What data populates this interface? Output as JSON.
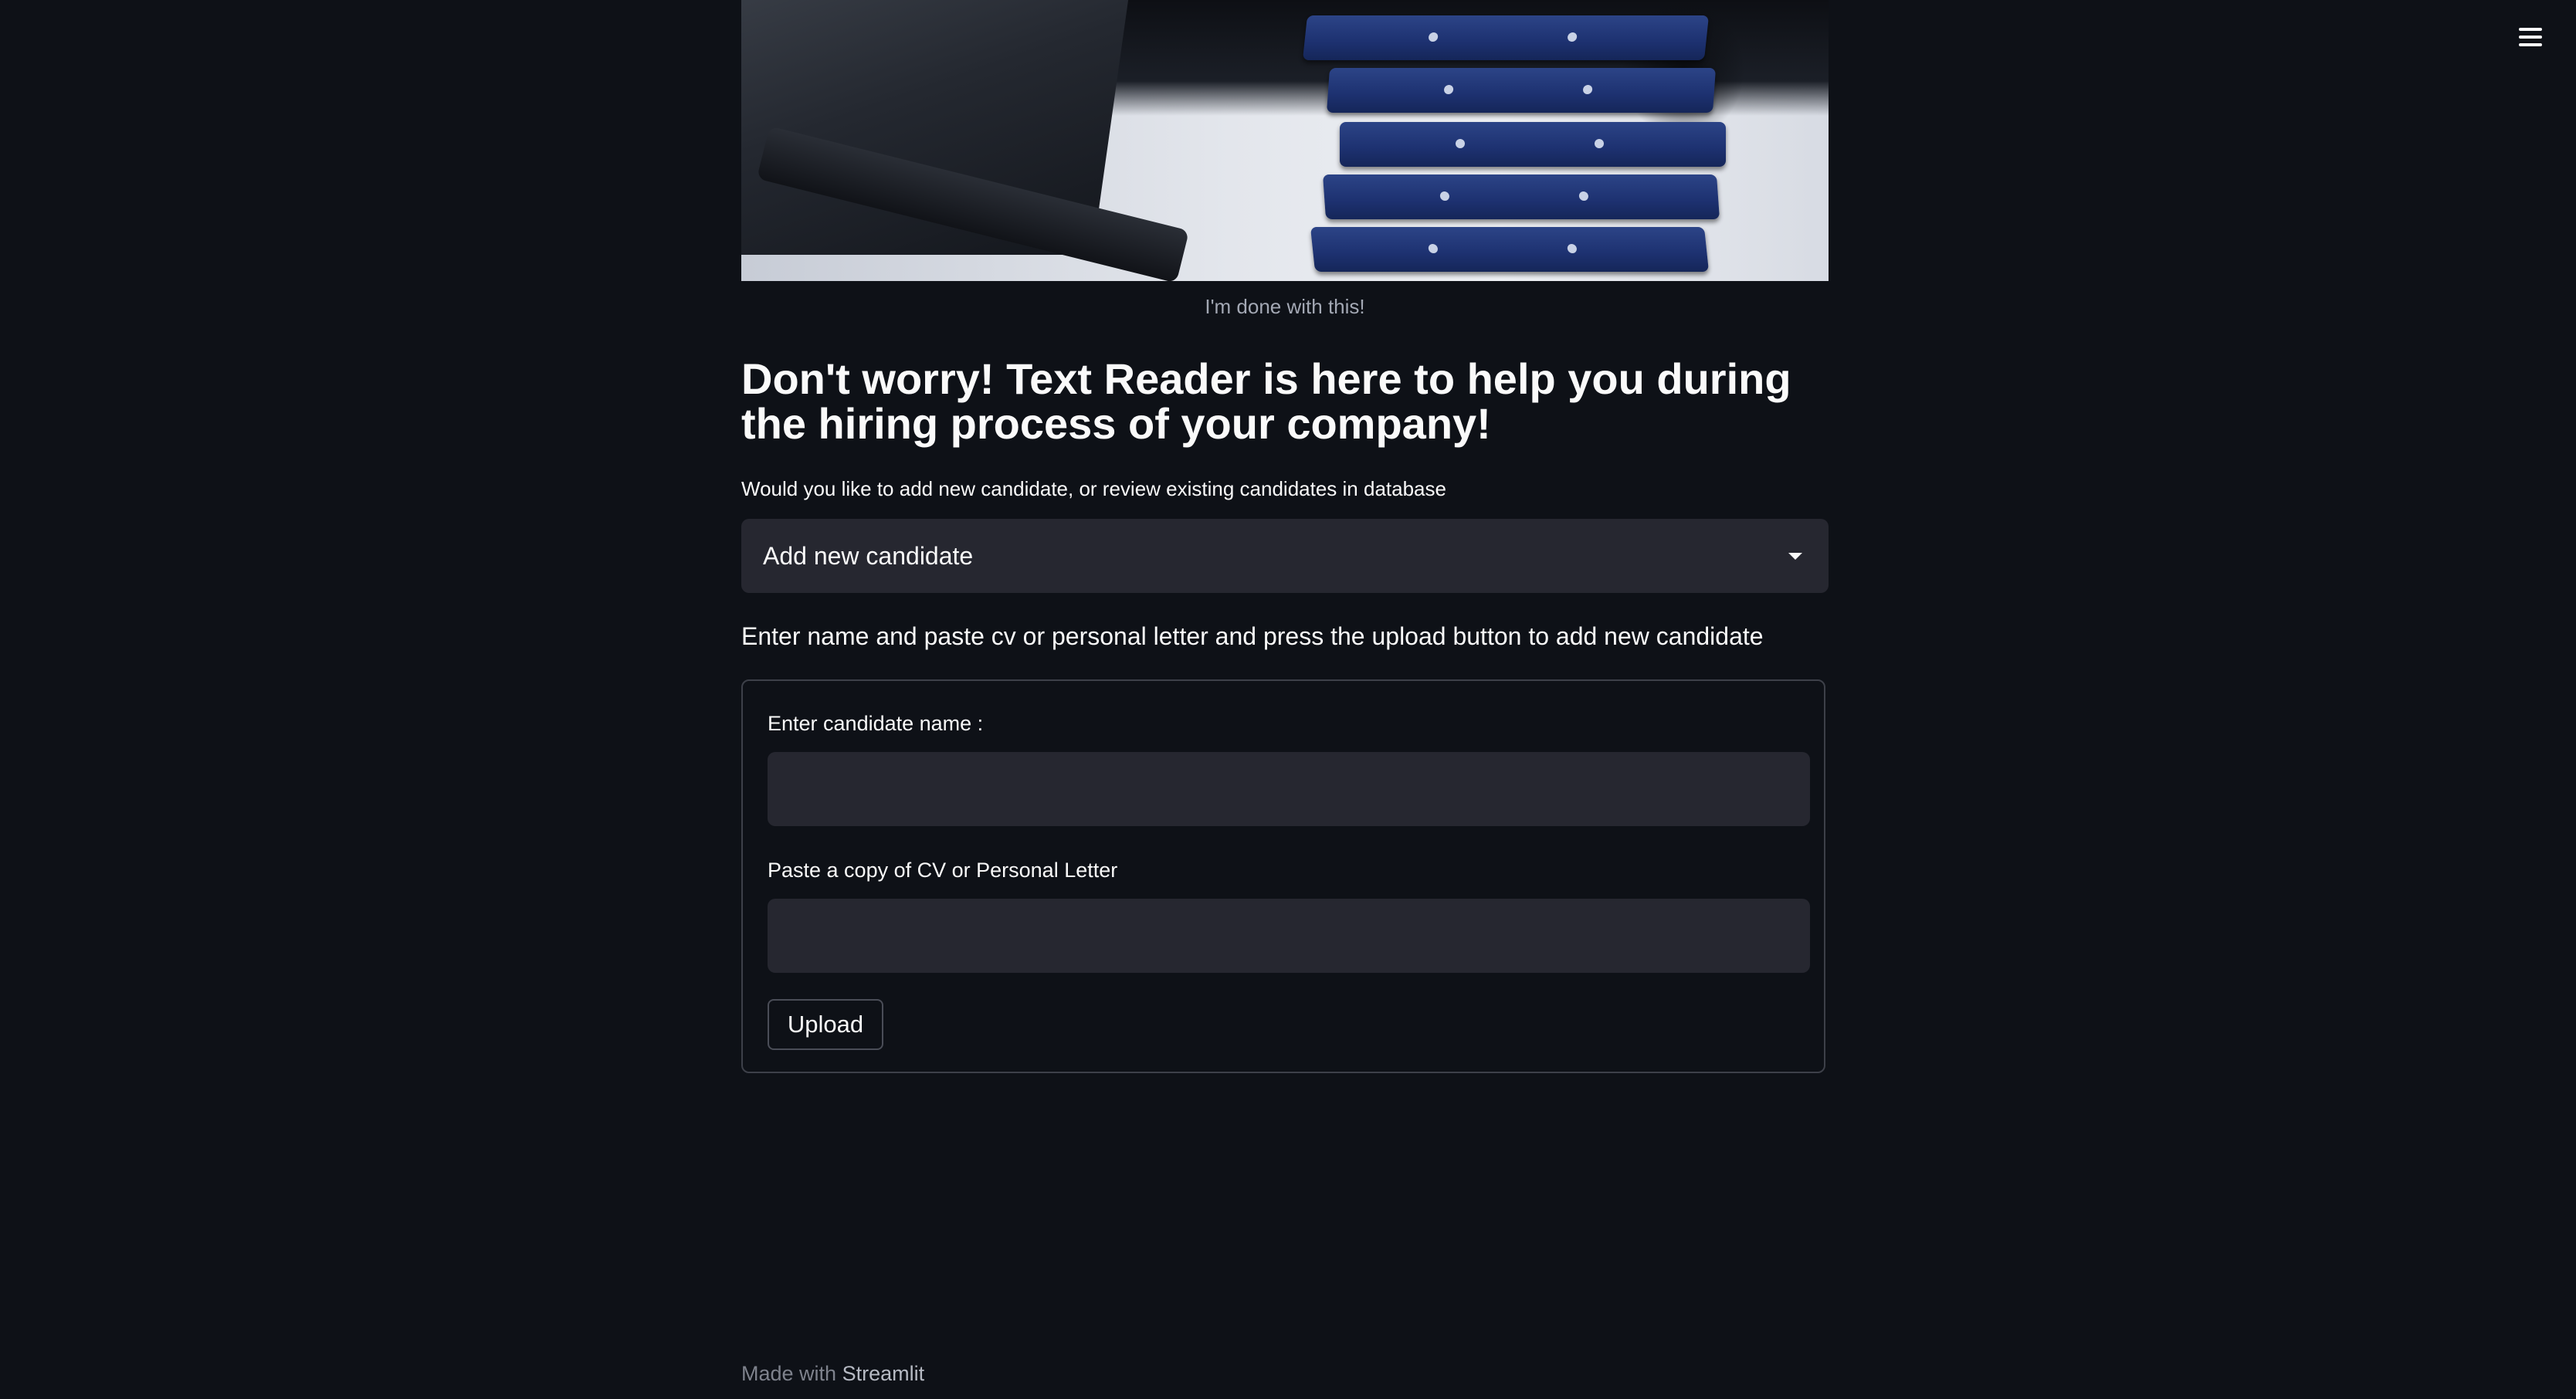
{
  "menu": {
    "icon": "hamburger-menu-icon"
  },
  "hero_image": {
    "caption": "I'm done with this!"
  },
  "headline": "Don't worry! Text Reader is here to help you during the hiring process of your company!",
  "mode_select": {
    "label": "Would you like to add new candidate, or review existing candidates in database",
    "selected": "Add new candidate",
    "icon": "chevron-down-icon"
  },
  "instructions": "Enter name and paste cv or personal letter and press the upload button to add new candidate",
  "form": {
    "name_label": "Enter candidate name :",
    "name_value": "",
    "cv_label": "Paste a copy of CV or Personal Letter",
    "cv_value": "",
    "upload_label": "Upload"
  },
  "footer": {
    "prefix": "Made with",
    "brand": "Streamlit"
  },
  "colors": {
    "background": "#0e1117",
    "input_bg": "#262730",
    "text": "#fafafa",
    "muted_text": "#a3a8b4",
    "binder_blue": "#1d3170"
  }
}
